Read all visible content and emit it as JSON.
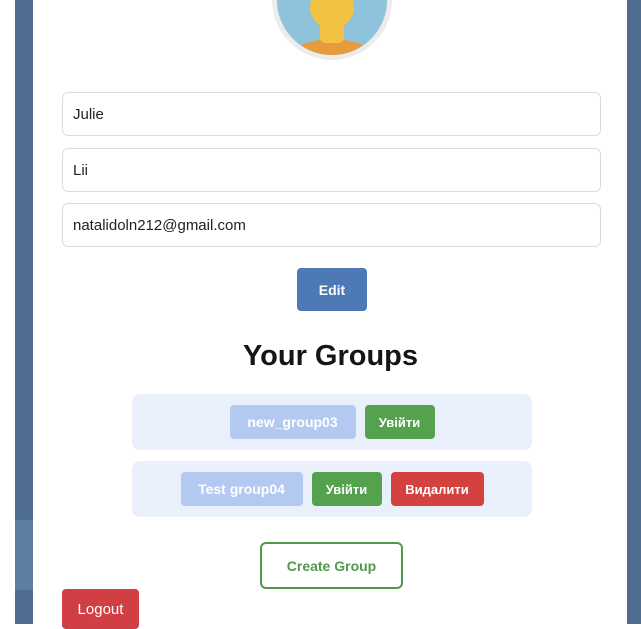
{
  "profile": {
    "first_name": "Julie",
    "last_name": "Lii",
    "email": "natalidoln212@gmail.com",
    "edit_label": "Edit"
  },
  "groups": {
    "title": "Your Groups",
    "items": [
      {
        "name": "new_group03",
        "enter_label": "Увійти"
      },
      {
        "name": "Test group04",
        "enter_label": "Увійти",
        "delete_label": "Видалити"
      }
    ],
    "create_label": "Create Group"
  },
  "logout_label": "Logout",
  "icons": {
    "avatar": "user-avatar-icon"
  },
  "colors": {
    "primary": "#4d79b6",
    "success": "#54a24e",
    "danger": "#d4423f",
    "group_chip": "#b3c9f1",
    "group_row_bg": "#eaf0fb",
    "side_panel": "#4f6d92"
  }
}
